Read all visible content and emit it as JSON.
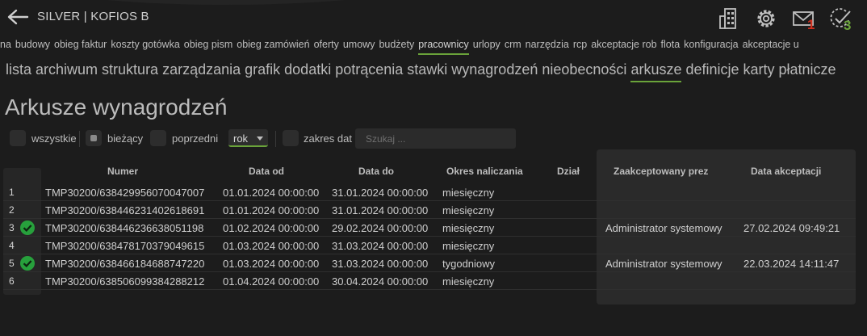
{
  "app_title": "SILVER | KOFIOS B",
  "header_icons": {
    "mail_badge": "1",
    "tasks_badge": "3",
    "mail_badge_color": "#d0301f",
    "tasks_badge_color": "#6aa33a"
  },
  "nav_modules": [
    {
      "label": "na"
    },
    {
      "label": "budowy"
    },
    {
      "label": "obieg faktur"
    },
    {
      "label": "koszty gotówka"
    },
    {
      "label": "obieg pism"
    },
    {
      "label": "obieg zamówień"
    },
    {
      "label": "oferty"
    },
    {
      "label": "umowy"
    },
    {
      "label": "budżety"
    },
    {
      "label": "pracownicy",
      "active": true
    },
    {
      "label": "urlopy"
    },
    {
      "label": "crm"
    },
    {
      "label": "narzędzia"
    },
    {
      "label": "rcp"
    },
    {
      "label": "akceptacje rob"
    },
    {
      "label": "flota"
    },
    {
      "label": "konfiguracja"
    },
    {
      "label": "akceptacje u"
    }
  ],
  "nav_sub": [
    {
      "label": "lista"
    },
    {
      "label": "archiwum"
    },
    {
      "label": "struktura zarządzania"
    },
    {
      "label": "grafik"
    },
    {
      "label": "dodatki"
    },
    {
      "label": "potrącenia"
    },
    {
      "label": "stawki wynagrodzeń"
    },
    {
      "label": "nieobecności"
    },
    {
      "label": "arkusze",
      "active": true
    },
    {
      "label": "definicje"
    },
    {
      "label": "karty płatnicze"
    }
  ],
  "page_title": "Arkusze wynagrodzeń",
  "filters": {
    "all_label": "wszystkie",
    "current_label": "bieżący",
    "previous_label": "poprzedni",
    "period_value": "rok",
    "date_range_label": "zakres dat",
    "search_placeholder": "Szukaj ..."
  },
  "accent_color": "#6aa33a",
  "table": {
    "columns": {
      "number": "Numer",
      "date_from": "Data od",
      "date_to": "Data do",
      "period": "Okres naliczania",
      "department": "Dział",
      "accepted_by": "Zaakceptowany prez",
      "accepted_date": "Data akceptacji"
    },
    "rows": [
      {
        "n": "1",
        "accepted": false,
        "number": "TMP30200/638429956070047007",
        "date_from": "01.01.2024 00:00:00",
        "date_to": "31.01.2024 00:00:00",
        "period": "miesięczny",
        "department": "",
        "accepted_by": "",
        "accepted_date": ""
      },
      {
        "n": "2",
        "accepted": false,
        "number": "TMP30200/638446231402618691",
        "date_from": "01.01.2024 00:00:00",
        "date_to": "31.01.2024 00:00:00",
        "period": "miesięczny",
        "department": "",
        "accepted_by": "",
        "accepted_date": ""
      },
      {
        "n": "3",
        "accepted": true,
        "number": "TMP30200/638446236638051198",
        "date_from": "01.02.2024 00:00:00",
        "date_to": "29.02.2024 00:00:00",
        "period": "miesięczny",
        "department": "",
        "accepted_by": "Administrator systemowy",
        "accepted_date": "27.02.2024 09:49:21"
      },
      {
        "n": "4",
        "accepted": false,
        "number": "TMP30200/638478170379049615",
        "date_from": "01.03.2024 00:00:00",
        "date_to": "31.03.2024 00:00:00",
        "period": "miesięczny",
        "department": "",
        "accepted_by": "",
        "accepted_date": ""
      },
      {
        "n": "5",
        "accepted": true,
        "number": "TMP30200/638466184688747220",
        "date_from": "01.03.2024 00:00:00",
        "date_to": "31.03.2024 00:00:00",
        "period": "tygodniowy",
        "department": "",
        "accepted_by": "Administrator systemowy",
        "accepted_date": "22.03.2024 14:11:47"
      },
      {
        "n": "6",
        "accepted": false,
        "number": "TMP30200/638506099384288212",
        "date_from": "01.04.2024 00:00:00",
        "date_to": "30.04.2024 00:00:00",
        "period": "miesięczny",
        "department": "",
        "accepted_by": "",
        "accepted_date": ""
      }
    ]
  }
}
